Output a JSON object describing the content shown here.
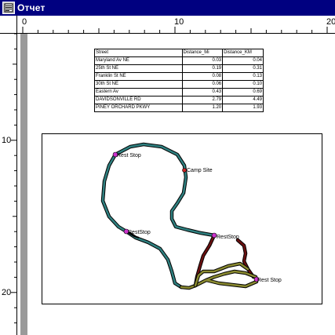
{
  "window": {
    "title": "Отчет"
  },
  "ruler": {
    "top_labels": [
      "0",
      "10",
      "20"
    ],
    "left_labels": [
      "10",
      "20"
    ]
  },
  "table": {
    "headers": [
      "Street",
      "Distance_Mi",
      "Distance_KM"
    ],
    "rows": [
      [
        "Maryland Av NE",
        "0.03",
        "0.04"
      ],
      [
        "25th St NE",
        "0.19",
        "0.31"
      ],
      [
        "Franklin St NE",
        "0.08",
        "0.13"
      ],
      [
        "30th St NE",
        "0.06",
        "0.10"
      ],
      [
        "Eastern Av",
        "0.43",
        "0.69"
      ],
      [
        "DAVIDSONVILLE RD",
        "2.79",
        "4.49"
      ],
      [
        "PINEY ORCHARD PKWY",
        "1.20",
        "1.93"
      ]
    ]
  },
  "map": {
    "labels": {
      "rest_stop_1": "Rest Stop",
      "camp_site": "Camp Site",
      "rest_stop_2": "RestStop",
      "rest_stop_3": "RestStop",
      "rest_stop_4": "Rest Stop"
    },
    "colors": {
      "route_teal": "#2f8080",
      "route_olive": "#8a8a30",
      "route_darkred": "#6a1010",
      "stop_marker": "#cc33cc",
      "camp_marker": "#cc2222"
    }
  }
}
